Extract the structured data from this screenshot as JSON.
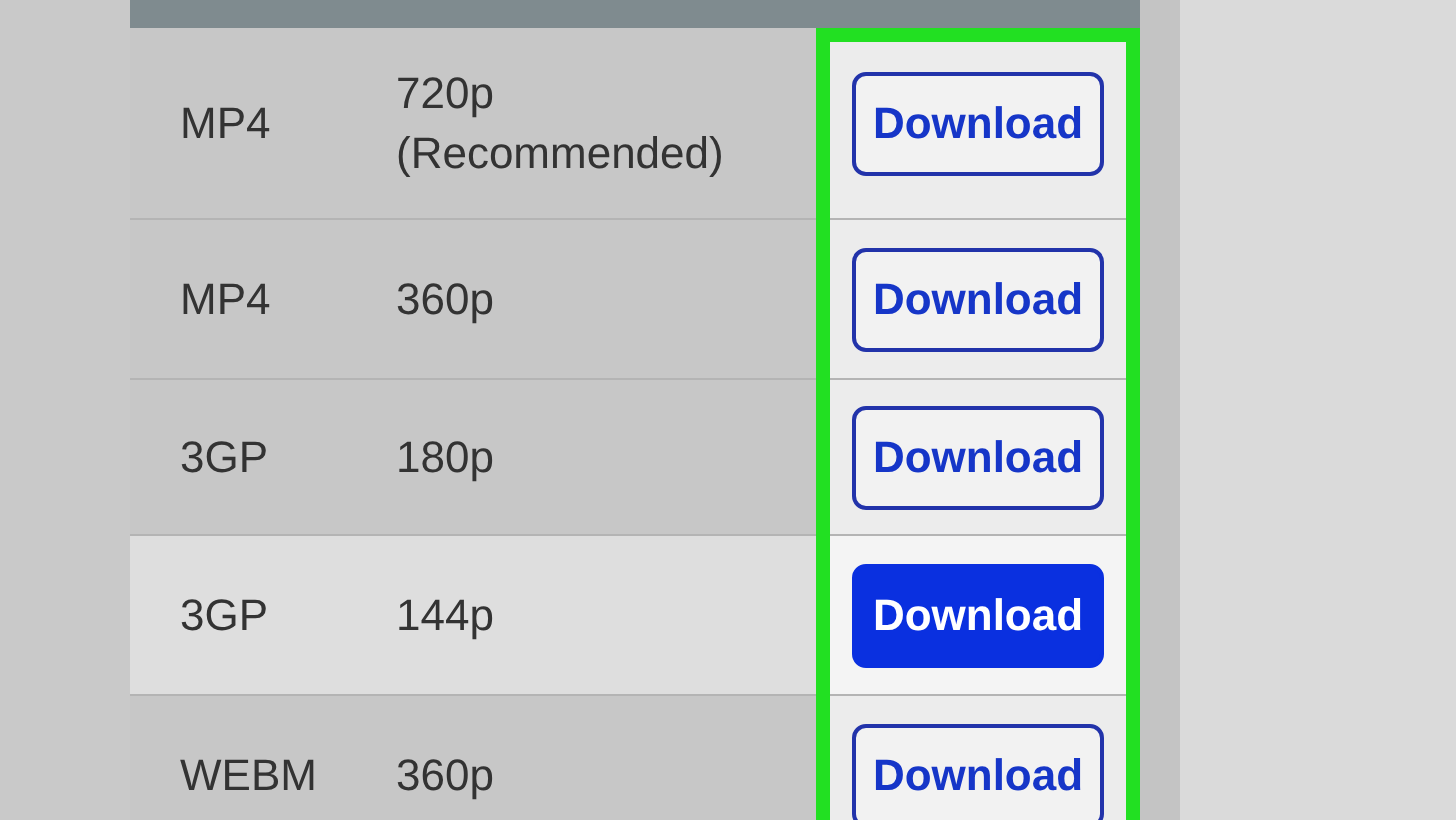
{
  "table": {
    "rows": [
      {
        "format": "MP4",
        "quality": "720p (Recommended)",
        "action": "Download",
        "pressed": false
      },
      {
        "format": "MP4",
        "quality": "360p",
        "action": "Download",
        "pressed": false
      },
      {
        "format": "3GP",
        "quality": "180p",
        "action": "Download",
        "pressed": false
      },
      {
        "format": "3GP",
        "quality": "144p",
        "action": "Download",
        "pressed": true
      },
      {
        "format": "WEBM",
        "quality": "360p",
        "action": "Download",
        "pressed": false
      }
    ]
  }
}
